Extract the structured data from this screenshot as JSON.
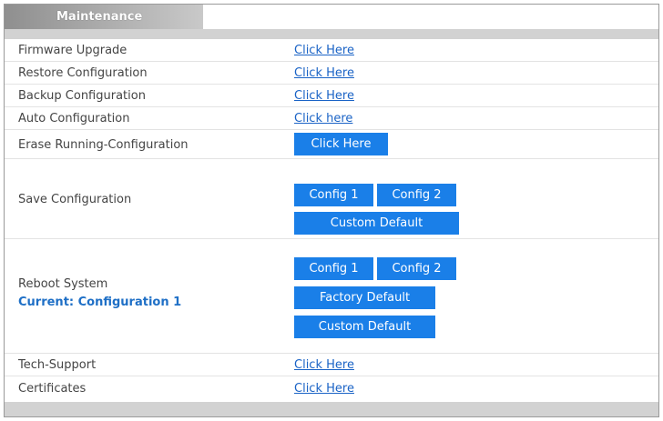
{
  "tab": {
    "title": "Maintenance"
  },
  "rows": {
    "firmware_upgrade": {
      "label": "Firmware Upgrade",
      "link": "Click Here"
    },
    "restore_configuration": {
      "label": "Restore Configuration",
      "link": "Click Here"
    },
    "backup_configuration": {
      "label": "Backup Configuration",
      "link": "Click Here"
    },
    "auto_configuration": {
      "label": "Auto Configuration",
      "link": "Click here"
    },
    "erase_running_configuration": {
      "label": "Erase Running-Configuration",
      "button": "Click Here"
    },
    "save_configuration": {
      "label": "Save Configuration",
      "config1": "Config 1",
      "config2": "Config 2",
      "custom_default": "Custom Default"
    },
    "reboot_system": {
      "label": "Reboot System",
      "current": "Current: Configuration 1",
      "config1": "Config 1",
      "config2": "Config 2",
      "factory_default": "Factory Default",
      "custom_default": "Custom Default"
    },
    "tech_support": {
      "label": "Tech-Support",
      "link": "Click Here"
    },
    "certificates": {
      "label": "Certificates",
      "link": "Click Here"
    }
  },
  "colors": {
    "button_bg": "#1a7fe8",
    "link": "#1a63c6",
    "current_config_text": "#1e6fc6",
    "header_gradient_start": "#8f8f8f",
    "header_gradient_end": "#c9c9c9",
    "bar_gray": "#d2d2d2"
  }
}
